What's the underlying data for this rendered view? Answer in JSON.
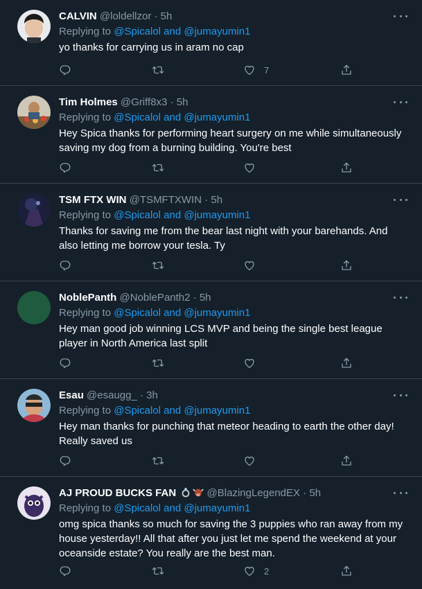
{
  "replying_prefix": "Replying to ",
  "tweets": [
    {
      "name": "CALVIN",
      "handle": "@loldellzor",
      "time": "5h",
      "mentions": "@Spicalol and @jumayumin1",
      "text": "yo thanks for carrying us in aram no cap",
      "likes": "7"
    },
    {
      "name": "Tim Holmes",
      "handle": "@Griff8x3",
      "time": "5h",
      "mentions": "@Spicalol and @jumayumin1",
      "text": "Hey Spica thanks for performing heart surgery on me while simultaneously saving my dog from a burning building. You're best",
      "likes": ""
    },
    {
      "name": "TSM FTX WIN",
      "handle": "@TSMFTXWIN",
      "time": "5h",
      "mentions": "@Spicalol and @jumayumin1",
      "text": "Thanks for saving me from the bear last night with your barehands. And also letting me borrow your tesla. Ty",
      "likes": ""
    },
    {
      "name": "NoblePanth",
      "handle": "@NoblePanth2",
      "time": "5h",
      "mentions": "@Spicalol and @jumayumin1",
      "text": "Hey man good job winning LCS MVP and being the single best league player in North America last split",
      "likes": ""
    },
    {
      "name": "Esau",
      "handle": "@esaugg_",
      "time": "3h",
      "mentions": "@Spicalol and @jumayumin1",
      "text": "Hey man thanks for punching that meteor heading to earth the other day! Really saved us",
      "likes": ""
    },
    {
      "name": "AJ PROUD BUCKS FAN",
      "handle": "@BlazingLegendEX",
      "time": "5h",
      "mentions": "@Spicalol and @jumayumin1",
      "text": "omg spica thanks so much for saving the 3 puppies who ran away from my house yesterday!!  All that after you just let me spend the weekend at your oceanside estate?  You really are the best man.",
      "likes": "2"
    }
  ],
  "icons": [
    "reply-icon",
    "retweet-icon",
    "like-icon",
    "share-icon",
    "more-icon",
    "ring-emoji-icon",
    "bull-emoji-icon"
  ],
  "colors": {
    "background": "#15202b",
    "link": "#1d9bf0",
    "muted": "#8899a6",
    "divider": "#38444d"
  }
}
